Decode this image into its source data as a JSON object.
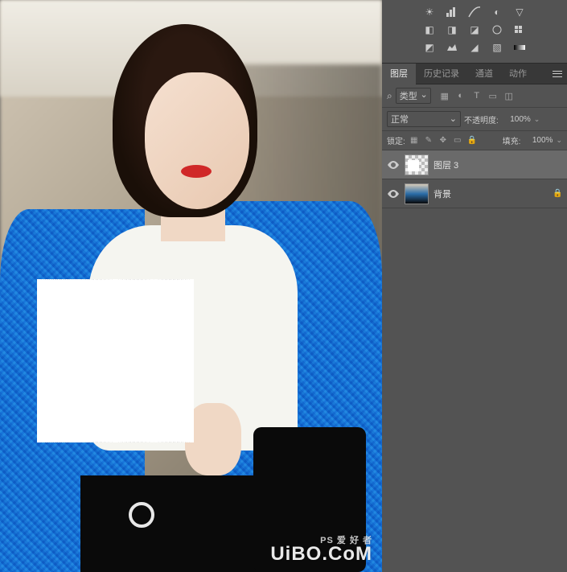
{
  "tabs": {
    "layers": "图层",
    "history": "历史记录",
    "channels": "通道",
    "actions": "动作"
  },
  "filter": {
    "label": "类型",
    "search_icon": "⌕"
  },
  "blend": {
    "mode": "正常",
    "opacity_label": "不透明度:",
    "opacity_value": "100%"
  },
  "lock": {
    "label": "锁定:",
    "fill_label": "填充:",
    "fill_value": "100%"
  },
  "layers": [
    {
      "name": "图层 3",
      "locked": false
    },
    {
      "name": "背景",
      "locked": true
    }
  ],
  "watermark": {
    "small": "PS 爱 好 者",
    "main": "UiBO.CoM"
  }
}
